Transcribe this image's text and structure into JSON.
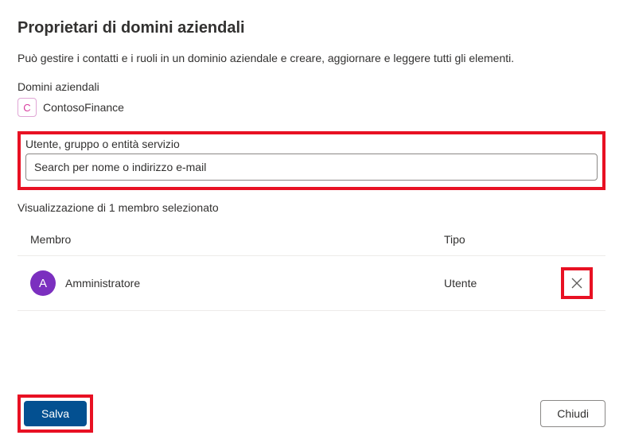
{
  "title": "Proprietari di domini aziendali",
  "description": "Può gestire i contatti e i ruoli in un dominio aziendale e creare, aggiornare e leggere tutti gli elementi.",
  "domainSection": {
    "label": "Domini aziendali",
    "chipInitial": "C",
    "chipName": "ContosoFinance"
  },
  "search": {
    "label": "Utente, gruppo o entità servizio",
    "placeholder": "Search per nome o indirizzo e-mail"
  },
  "viewCount": "Visualizzazione di 1 membro selezionato",
  "table": {
    "headers": {
      "member": "Membro",
      "type": "Tipo"
    },
    "rows": [
      {
        "avatarInitial": "A",
        "name": "Amministratore",
        "type": "Utente"
      }
    ]
  },
  "footer": {
    "save": "Salva",
    "close": "Chiudi"
  }
}
